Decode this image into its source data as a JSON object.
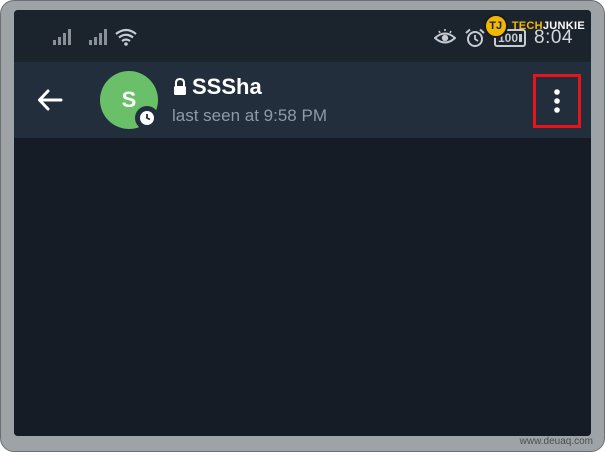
{
  "status_bar": {
    "time": "8:04",
    "battery_level": "100",
    "icons": [
      "signal-icon",
      "signal-icon",
      "wifi-icon",
      "eye-icon",
      "alarm-icon",
      "battery-icon"
    ]
  },
  "watermark": {
    "brand_prefix": "TECH",
    "brand_suffix": "JUNKIE",
    "logo_letters": "TJ"
  },
  "toolbar": {
    "avatar_letter": "S",
    "chat_title": "SSSha",
    "last_seen": "last seen at 9:58 PM",
    "back_icon": "arrow-left-icon",
    "menu_icon": "more-vertical-icon"
  },
  "footer": {
    "credit": "www.deuaq.com"
  },
  "colors": {
    "screen_bg": "#151c26",
    "toolbar_bg": "#232e3c",
    "avatar_bg": "#6abf69",
    "highlight": "#e3151b",
    "subtitle": "#8d9aa8"
  }
}
